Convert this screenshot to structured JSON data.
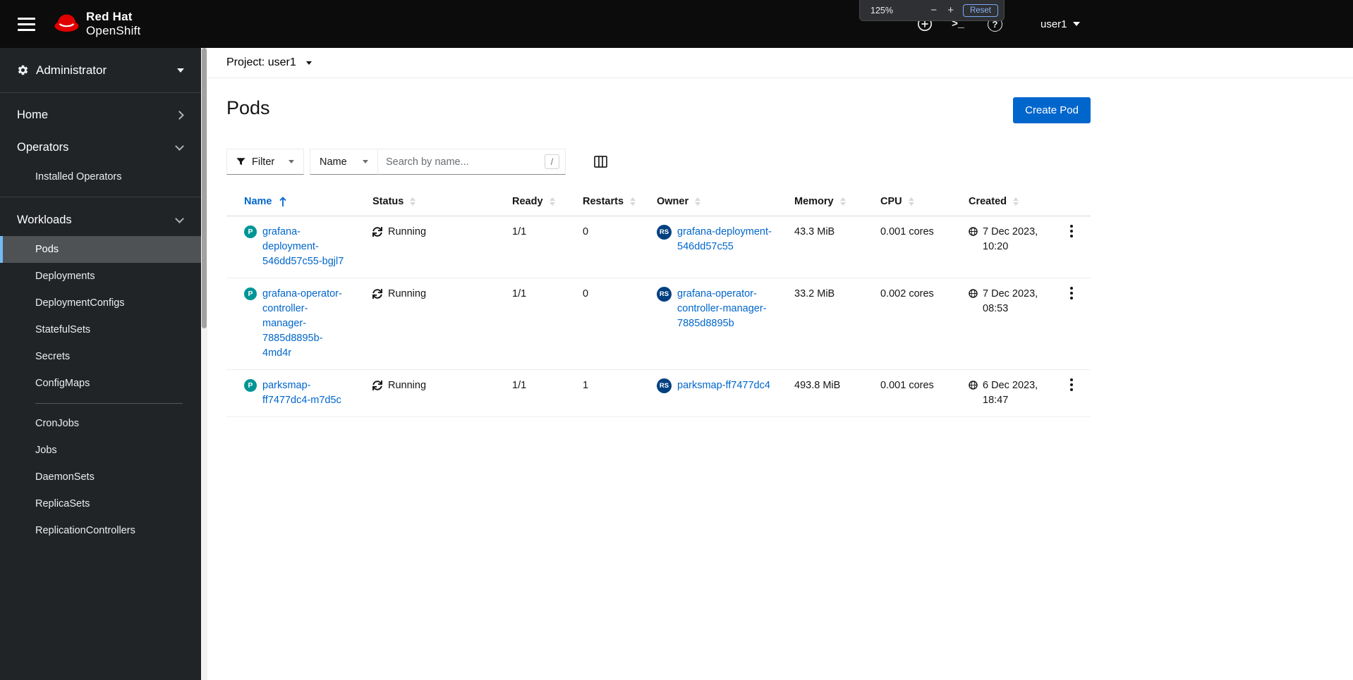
{
  "colors": {
    "accent": "#0066cc",
    "pod_badge": "#009596",
    "replicaset_badge": "#004080",
    "nav_selected_border": "#73bcf7",
    "masthead_bg": "#0c0c0c",
    "sidebar_bg": "#212427"
  },
  "masthead": {
    "brand_line1": "Red Hat",
    "brand_line2": "OpenShift",
    "terminal_icon_glyph": ">_",
    "help_icon_glyph": "?",
    "username": "user1"
  },
  "zoom_popup": {
    "level": "125%",
    "minus": "−",
    "plus": "+",
    "reset": "Reset"
  },
  "sidebar": {
    "perspective": "Administrator",
    "items": {
      "home": "Home",
      "operators": "Operators",
      "installed_operators": "Installed Operators",
      "workloads": "Workloads",
      "pods": "Pods",
      "deployments": "Deployments",
      "deployment_configs": "DeploymentConfigs",
      "stateful_sets": "StatefulSets",
      "secrets": "Secrets",
      "config_maps": "ConfigMaps",
      "cron_jobs": "CronJobs",
      "jobs": "Jobs",
      "daemon_sets": "DaemonSets",
      "replica_sets": "ReplicaSets",
      "replication_controllers": "ReplicationControllers"
    }
  },
  "project_bar": {
    "label": "Project: user1"
  },
  "page": {
    "title": "Pods",
    "create_button": "Create Pod"
  },
  "toolbar": {
    "filter_label": "Filter",
    "attribute_label": "Name",
    "search_placeholder": "Search by name...",
    "shortcut_key": "/"
  },
  "table": {
    "columns": {
      "name": "Name",
      "status": "Status",
      "ready": "Ready",
      "restarts": "Restarts",
      "owner": "Owner",
      "memory": "Memory",
      "cpu": "CPU",
      "created": "Created"
    },
    "rows": [
      {
        "badge": "P",
        "name": "grafana-deployment-546dd57c55-bgjl7",
        "status": "Running",
        "ready": "1/1",
        "restarts": "0",
        "owner_badge": "RS",
        "owner": "grafana-deployment-546dd57c55",
        "memory": "43.3 MiB",
        "cpu": "0.001 cores",
        "created": "7 Dec 2023, 10:20"
      },
      {
        "badge": "P",
        "name": "grafana-operator-controller-manager-7885d8895b-4md4r",
        "status": "Running",
        "ready": "1/1",
        "restarts": "0",
        "owner_badge": "RS",
        "owner": "grafana-operator-controller-manager-7885d8895b",
        "memory": "33.2 MiB",
        "cpu": "0.002 cores",
        "created": "7 Dec 2023, 08:53"
      },
      {
        "badge": "P",
        "name": "parksmap-ff7477dc4-m7d5c",
        "status": "Running",
        "ready": "1/1",
        "restarts": "1",
        "owner_badge": "RS",
        "owner": "parksmap-ff7477dc4",
        "memory": "493.8 MiB",
        "cpu": "0.001 cores",
        "created": "6 Dec 2023, 18:47"
      }
    ]
  }
}
